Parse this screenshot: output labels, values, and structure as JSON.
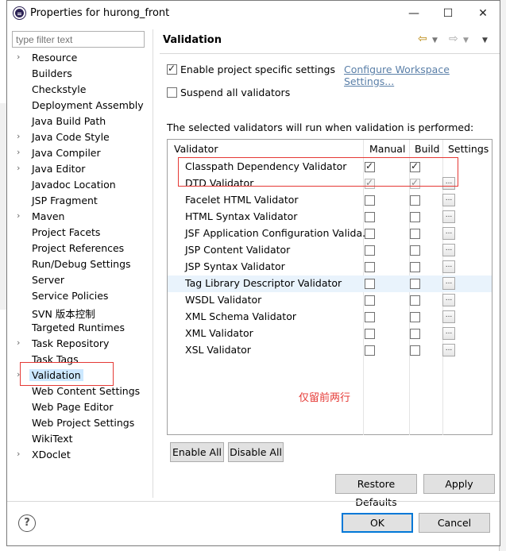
{
  "window": {
    "title": "Properties for hurong_front",
    "minimize": "—",
    "maximize": "☐",
    "close": "✕"
  },
  "filter": {
    "placeholder": "type filter text"
  },
  "tree": [
    {
      "label": "Resource",
      "arrow": true
    },
    {
      "label": "Builders",
      "arrow": false
    },
    {
      "label": "Checkstyle",
      "arrow": false
    },
    {
      "label": "Deployment Assembly",
      "arrow": false
    },
    {
      "label": "Java Build Path",
      "arrow": false
    },
    {
      "label": "Java Code Style",
      "arrow": true
    },
    {
      "label": "Java Compiler",
      "arrow": true
    },
    {
      "label": "Java Editor",
      "arrow": true
    },
    {
      "label": "Javadoc Location",
      "arrow": false
    },
    {
      "label": "JSP Fragment",
      "arrow": false
    },
    {
      "label": "Maven",
      "arrow": true
    },
    {
      "label": "Project Facets",
      "arrow": false
    },
    {
      "label": "Project References",
      "arrow": false
    },
    {
      "label": "Run/Debug Settings",
      "arrow": false
    },
    {
      "label": "Server",
      "arrow": false
    },
    {
      "label": "Service Policies",
      "arrow": false
    },
    {
      "label": "SVN 版本控制",
      "arrow": false
    },
    {
      "label": "Targeted Runtimes",
      "arrow": false
    },
    {
      "label": "Task Repository",
      "arrow": true
    },
    {
      "label": "Task Tags",
      "arrow": false
    },
    {
      "label": "Validation",
      "arrow": true,
      "selected": true
    },
    {
      "label": "Web Content Settings",
      "arrow": false
    },
    {
      "label": "Web Page Editor",
      "arrow": false
    },
    {
      "label": "Web Project Settings",
      "arrow": false
    },
    {
      "label": "WikiText",
      "arrow": false
    },
    {
      "label": "XDoclet",
      "arrow": true
    }
  ],
  "page": {
    "title": "Validation",
    "enable_specific": "Enable project specific settings",
    "configure_link": "Configure Workspace Settings...",
    "suspend_all": "Suspend all validators",
    "description": "The selected validators will run when validation is performed:"
  },
  "table": {
    "headers": {
      "validator": "Validator",
      "manual": "Manual",
      "build": "Build",
      "settings": "Settings"
    },
    "rows": [
      {
        "name": "Classpath Dependency Validator",
        "manual": true,
        "build": true,
        "settings": false,
        "highlight": false
      },
      {
        "name": "DTD Validator",
        "manual": true,
        "build": true,
        "settings": true,
        "highlight": false
      },
      {
        "name": "Facelet HTML Validator",
        "manual": false,
        "build": false,
        "settings": true,
        "highlight": false
      },
      {
        "name": "HTML Syntax Validator",
        "manual": false,
        "build": false,
        "settings": true,
        "highlight": false
      },
      {
        "name": "JSF Application Configuration Valida...",
        "manual": false,
        "build": false,
        "settings": true,
        "highlight": false
      },
      {
        "name": "JSP Content Validator",
        "manual": false,
        "build": false,
        "settings": true,
        "highlight": false
      },
      {
        "name": "JSP Syntax Validator",
        "manual": false,
        "build": false,
        "settings": true,
        "highlight": false
      },
      {
        "name": "Tag Library Descriptor Validator",
        "manual": false,
        "build": false,
        "settings": true,
        "highlight": true
      },
      {
        "name": "WSDL Validator",
        "manual": false,
        "build": false,
        "settings": true,
        "highlight": false
      },
      {
        "name": "XML Schema Validator",
        "manual": false,
        "build": false,
        "settings": true,
        "highlight": false
      },
      {
        "name": "XML Validator",
        "manual": false,
        "build": false,
        "settings": true,
        "highlight": false
      },
      {
        "name": "XSL Validator",
        "manual": false,
        "build": false,
        "settings": true,
        "highlight": false
      }
    ],
    "settings_button": "..."
  },
  "annotation": "仅留前两行",
  "buttons": {
    "enable_all": "Enable All",
    "disable_all": "Disable All",
    "restore_defaults": "Restore Defaults",
    "apply": "Apply",
    "ok": "OK",
    "cancel": "Cancel"
  },
  "help": "?",
  "colors": {
    "selection": "#cce8ff",
    "row_highlight": "#e9f3fc",
    "annotation_red": "#e53935",
    "ok_border": "#0078d7"
  }
}
